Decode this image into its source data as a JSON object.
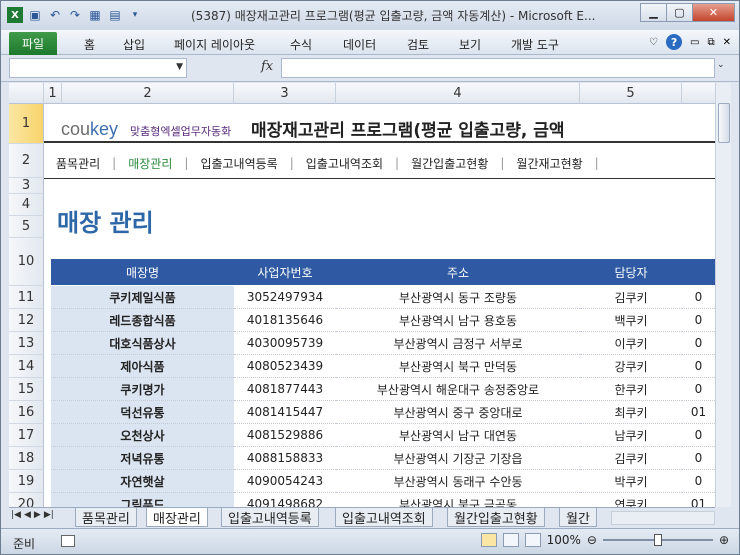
{
  "window": {
    "title": "(5387) 매장재고관리 프로그램(평균 입출고량, 금액 자동계산) - Microsoft E..."
  },
  "ribbon": {
    "file_tab": "파일",
    "tabs": [
      "홈",
      "삽입",
      "페이지 레이아웃",
      "수식",
      "데이터",
      "검토",
      "보기",
      "개발 도구"
    ]
  },
  "formula_bar": {
    "fx": "fx",
    "name_box": "",
    "value": ""
  },
  "columns": [
    "1",
    "2",
    "3",
    "4",
    "5"
  ],
  "rows": [
    "1",
    "2",
    "3",
    "4",
    "5",
    "10",
    "11",
    "12",
    "13",
    "14",
    "15",
    "16",
    "17",
    "18",
    "19",
    "20"
  ],
  "header": {
    "logo_co": "cou",
    "logo_key": "key",
    "slogan": "맞춤형엑셀업무자동화",
    "title": "매장재고관리 프로그램(평균 입출고량, 금액"
  },
  "nav": {
    "items": [
      "품목관리",
      "매장관리",
      "입출고내역등록",
      "입출고내역조회",
      "월간입출고현황",
      "월간재고현황"
    ],
    "active": "매장관리"
  },
  "page_heading": "매장 관리",
  "table": {
    "columns": [
      "매장명",
      "사업자번호",
      "주소",
      "담당자"
    ],
    "rows": [
      {
        "name": "쿠키제일식품",
        "biz": "3052497934",
        "addr": "부산광역시 동구 조량동",
        "mgr": "김쿠키",
        "extra": "0"
      },
      {
        "name": "레드종합식품",
        "biz": "4018135646",
        "addr": "부산광역시 남구 용호동",
        "mgr": "백쿠키",
        "extra": "0"
      },
      {
        "name": "대호식품상사",
        "biz": "4030095739",
        "addr": "부산광역시 금정구 서부로",
        "mgr": "이쿠키",
        "extra": "0"
      },
      {
        "name": "제아식품",
        "biz": "4080523439",
        "addr": "부산광역시 북구 만덕동",
        "mgr": "강쿠키",
        "extra": "0"
      },
      {
        "name": "쿠키명가",
        "biz": "4081877443",
        "addr": "부산광역시 해운대구 송정중앙로",
        "mgr": "한쿠키",
        "extra": "0"
      },
      {
        "name": "덕선유통",
        "biz": "4081415447",
        "addr": "부산광역시 중구 중앙대로",
        "mgr": "최쿠키",
        "extra": "01"
      },
      {
        "name": "오천상사",
        "biz": "4081529886",
        "addr": "부산광역시 남구 대연동",
        "mgr": "남쿠키",
        "extra": "0"
      },
      {
        "name": "저녁유통",
        "biz": "4088158833",
        "addr": "부산광역시 기장군 기장읍",
        "mgr": "김쿠키",
        "extra": "0"
      },
      {
        "name": "자연햇살",
        "biz": "4090054243",
        "addr": "부산광역시 동래구 수안동",
        "mgr": "박쿠키",
        "extra": "0"
      },
      {
        "name": "그림푸드",
        "biz": "4091498682",
        "addr": "부산광역시 북구 금곡동",
        "mgr": "연쿠키",
        "extra": "01"
      }
    ]
  },
  "sheet_tabs": [
    "품목관리",
    "매장관리",
    "입출고내역등록",
    "입출고내역조회",
    "월간입출고현황",
    "월간"
  ],
  "active_sheet": "매장관리",
  "status": {
    "ready": "준비",
    "zoom": "100%"
  }
}
